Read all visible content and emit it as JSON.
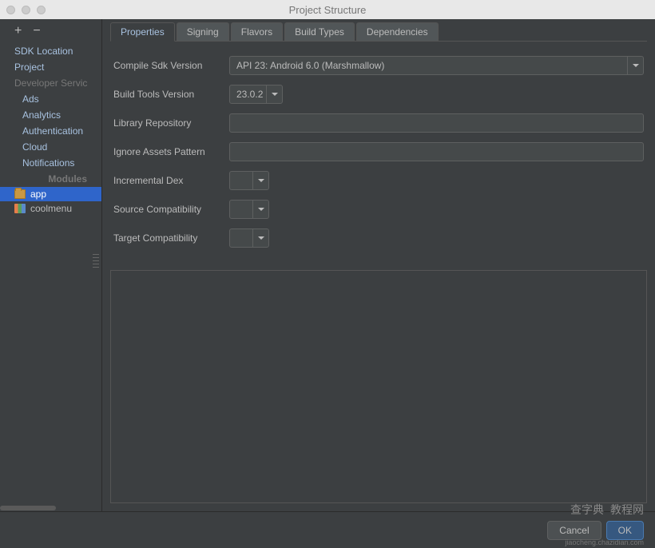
{
  "window": {
    "title": "Project Structure"
  },
  "sidebar": {
    "items": [
      {
        "label": "SDK Location"
      },
      {
        "label": "Project"
      }
    ],
    "developerServices": {
      "heading": "Developer Servic",
      "items": [
        {
          "label": "Ads"
        },
        {
          "label": "Analytics"
        },
        {
          "label": "Authentication"
        },
        {
          "label": "Cloud"
        },
        {
          "label": "Notifications"
        }
      ]
    },
    "modules": {
      "heading": "Modules",
      "items": [
        {
          "label": "app",
          "selected": true,
          "icon": "folder"
        },
        {
          "label": "coolmenu",
          "selected": false,
          "icon": "chart"
        }
      ]
    }
  },
  "tabs": [
    {
      "label": "Properties",
      "active": true
    },
    {
      "label": "Signing",
      "active": false
    },
    {
      "label": "Flavors",
      "active": false
    },
    {
      "label": "Build Types",
      "active": false
    },
    {
      "label": "Dependencies",
      "active": false
    }
  ],
  "form": {
    "compileSdk": {
      "label": "Compile Sdk Version",
      "value": "API 23: Android 6.0 (Marshmallow)"
    },
    "buildTools": {
      "label": "Build Tools Version",
      "value": "23.0.2"
    },
    "libraryRepo": {
      "label": "Library Repository",
      "value": ""
    },
    "ignoreAssets": {
      "label": "Ignore Assets Pattern",
      "value": ""
    },
    "incrementalDex": {
      "label": "Incremental Dex",
      "value": ""
    },
    "sourceCompat": {
      "label": "Source Compatibility",
      "value": ""
    },
    "targetCompat": {
      "label": "Target Compatibility",
      "value": ""
    }
  },
  "footer": {
    "cancel": "Cancel",
    "ok": "OK"
  },
  "watermark": {
    "text1": "查字典",
    "text2": "教程网",
    "url": "jiaocheng.chazidian.com"
  }
}
